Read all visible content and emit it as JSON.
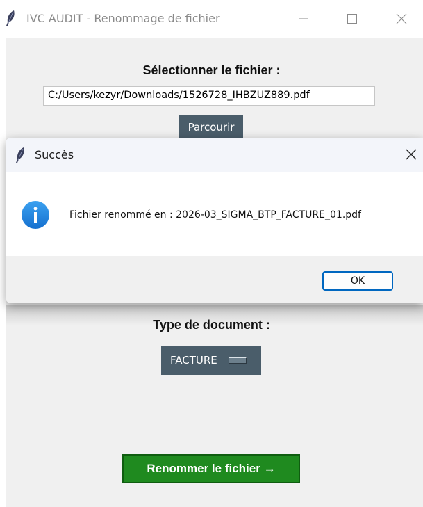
{
  "window": {
    "title": "IVC AUDIT - Renommage de fichier",
    "icon": "feather-icon",
    "controls": [
      "minimize-icon",
      "maximize-icon",
      "close-icon"
    ]
  },
  "file_section": {
    "label": "Sélectionner le fichier :",
    "path_value": "C:/Users/kezyr/Downloads/1526728_IHBZUZ889.pdf",
    "browse_label": "Parcourir"
  },
  "doc_type": {
    "label": "Type de document :",
    "selected": "FACTURE",
    "indicator_icon": "option-menu-indicator-icon"
  },
  "rename_button": {
    "label": "Renommer le fichier →"
  },
  "dialog": {
    "title": "Succès",
    "icon": "info-icon",
    "message": "Fichier renommé en : 2026-03_SIGMA_BTP_FACTURE_01.pdf",
    "ok_label": "OK"
  },
  "colors": {
    "accent_button": "#4a5d6a",
    "rename_button": "#1f8a1f",
    "info_icon": "#1e88e5",
    "ok_border": "#0067c0",
    "client_bg": "#f0f0f0"
  }
}
